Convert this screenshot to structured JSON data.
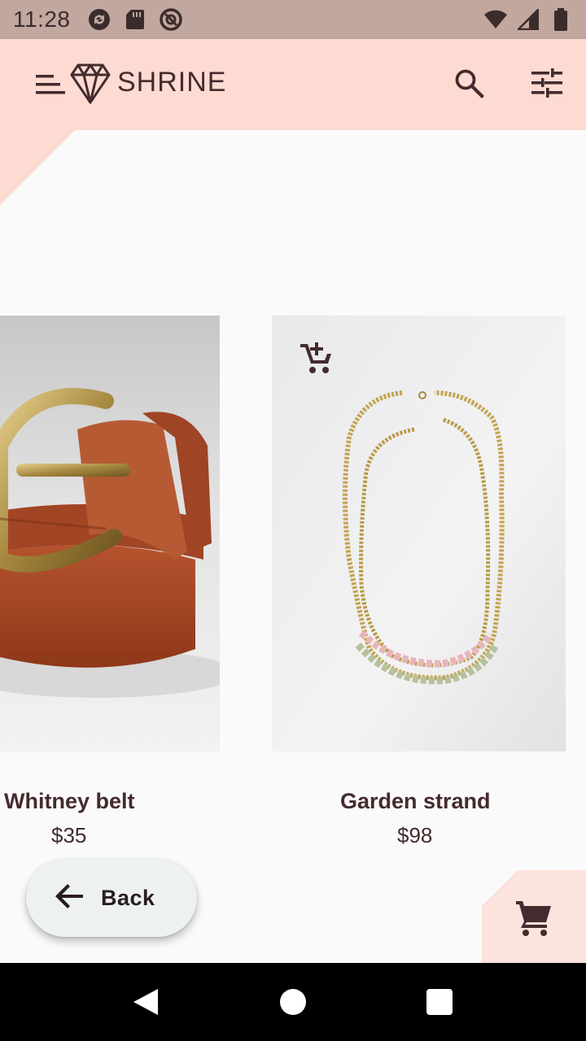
{
  "status_bar": {
    "time": "11:28",
    "left_icons": [
      "sync-icon",
      "sd-card-icon",
      "at-sign-icon"
    ],
    "right_icons": [
      "wifi-icon",
      "signal-icon",
      "battery-icon"
    ],
    "background": "#c2a79f"
  },
  "app_bar": {
    "brand": "SHRINE",
    "background": "#fddbd2",
    "icons": [
      "menu-icon",
      "diamond-logo-icon",
      "search-icon",
      "tune-icon"
    ]
  },
  "products": [
    {
      "name": "Whitney belt",
      "price": "$35",
      "image": "brown leather belt with brass buckle"
    },
    {
      "name": "Garden strand",
      "price": "$98",
      "image": "double beaded gold necklace"
    }
  ],
  "actions": {
    "back_label": "Back",
    "add_to_cart_icon": "add-shopping-cart-icon",
    "cart_icon": "shopping-cart-icon"
  },
  "colors": {
    "primary_pink": "#fddbd2",
    "text_brown": "#442b2d",
    "surface": "#fafafa"
  }
}
